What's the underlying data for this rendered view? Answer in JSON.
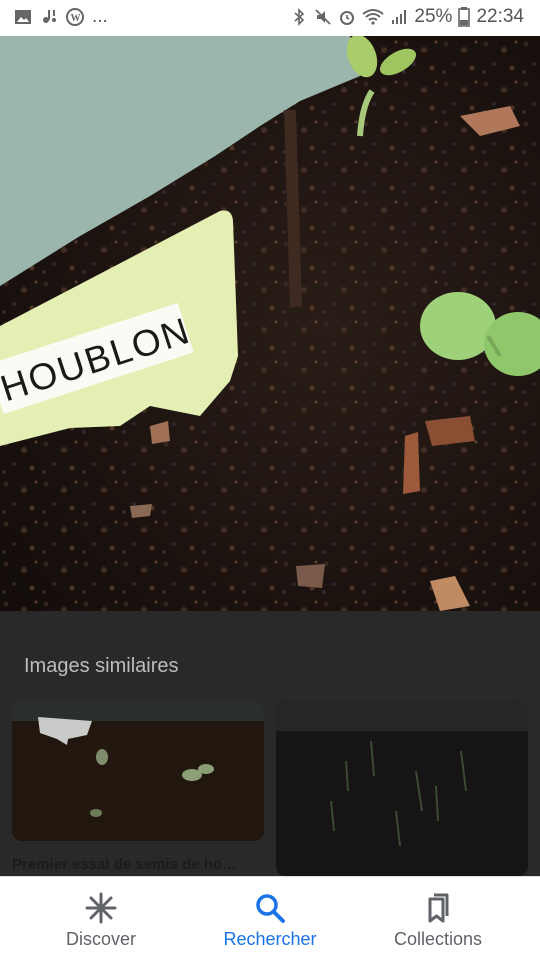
{
  "status_bar": {
    "battery": "25%",
    "time": "22:34",
    "ellipsis": "..."
  },
  "photo": {
    "label_text": "HOUBLON"
  },
  "similar": {
    "title": "Images similaires",
    "items": [
      {
        "caption": "Premier essai de semis de ho…"
      },
      {
        "caption": ""
      }
    ]
  },
  "bottom_nav": {
    "items": [
      {
        "label": "Discover",
        "icon": "asterisk-icon"
      },
      {
        "label": "Rechercher",
        "icon": "search-icon",
        "active": true
      },
      {
        "label": "Collections",
        "icon": "bookmarks-icon"
      }
    ]
  },
  "colors": {
    "accent": "#1a73e8",
    "nav_inactive": "#5f6368"
  }
}
